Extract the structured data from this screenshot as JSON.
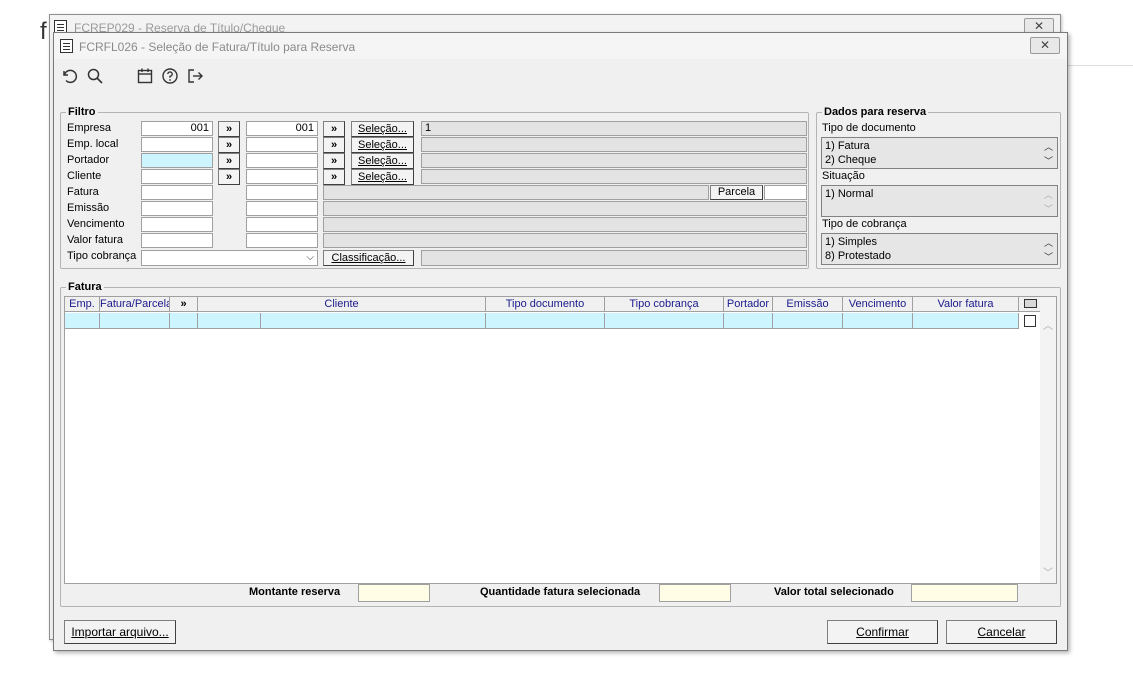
{
  "background": {
    "char": "f"
  },
  "back_window": {
    "title": "FCREP029 - Reserva de Título/Cheque",
    "close": "✕"
  },
  "window": {
    "title": "FCRFL026 - Seleção de Fatura/Título para Reserva",
    "close": "✕"
  },
  "toolbar": {
    "icons": [
      "undo-icon",
      "search-icon",
      "calendar-icon",
      "help-icon",
      "exit-icon"
    ]
  },
  "filtro": {
    "legend": "Filtro",
    "labels": {
      "empresa": "Empresa",
      "emp_local": "Emp. local",
      "portador": "Portador",
      "cliente": "Cliente",
      "fatura": "Fatura",
      "emissao": "Emissão",
      "vencimento": "Vencimento",
      "valor_fatura": "Valor fatura",
      "tipo_cobranca": "Tipo cobrança"
    },
    "empresa_from": "001",
    "empresa_to": "001",
    "empresa_desc": "1",
    "arrow": "»",
    "selecao": "Seleção...",
    "parcela": "Parcela",
    "classificacao": "Classificação..."
  },
  "dados": {
    "legend": "Dados para reserva",
    "tipo_documento_label": "Tipo de documento",
    "tipo_documento_items": [
      "1) Fatura",
      "2) Cheque"
    ],
    "situacao_label": "Situação",
    "situacao_items": [
      "1) Normal"
    ],
    "tipo_cobranca_label": "Tipo de cobrança",
    "tipo_cobranca_items": [
      "1) Simples",
      "8) Protestado"
    ]
  },
  "fatura": {
    "legend": "Fatura",
    "columns": [
      "Emp.",
      "Fatura/Parcela",
      "»",
      "Cliente",
      "Tipo documento",
      "Tipo cobrança",
      "Portador",
      "Emissão",
      "Vencimento",
      "Valor fatura"
    ]
  },
  "footer": {
    "montante_reserva": "Montante reserva",
    "quantidade_fatura": "Quantidade fatura selecionada",
    "valor_total": "Valor total selecionado"
  },
  "buttons": {
    "importar": "Importar arquivo...",
    "confirmar": "Confirmar",
    "cancelar": "Cancelar"
  }
}
